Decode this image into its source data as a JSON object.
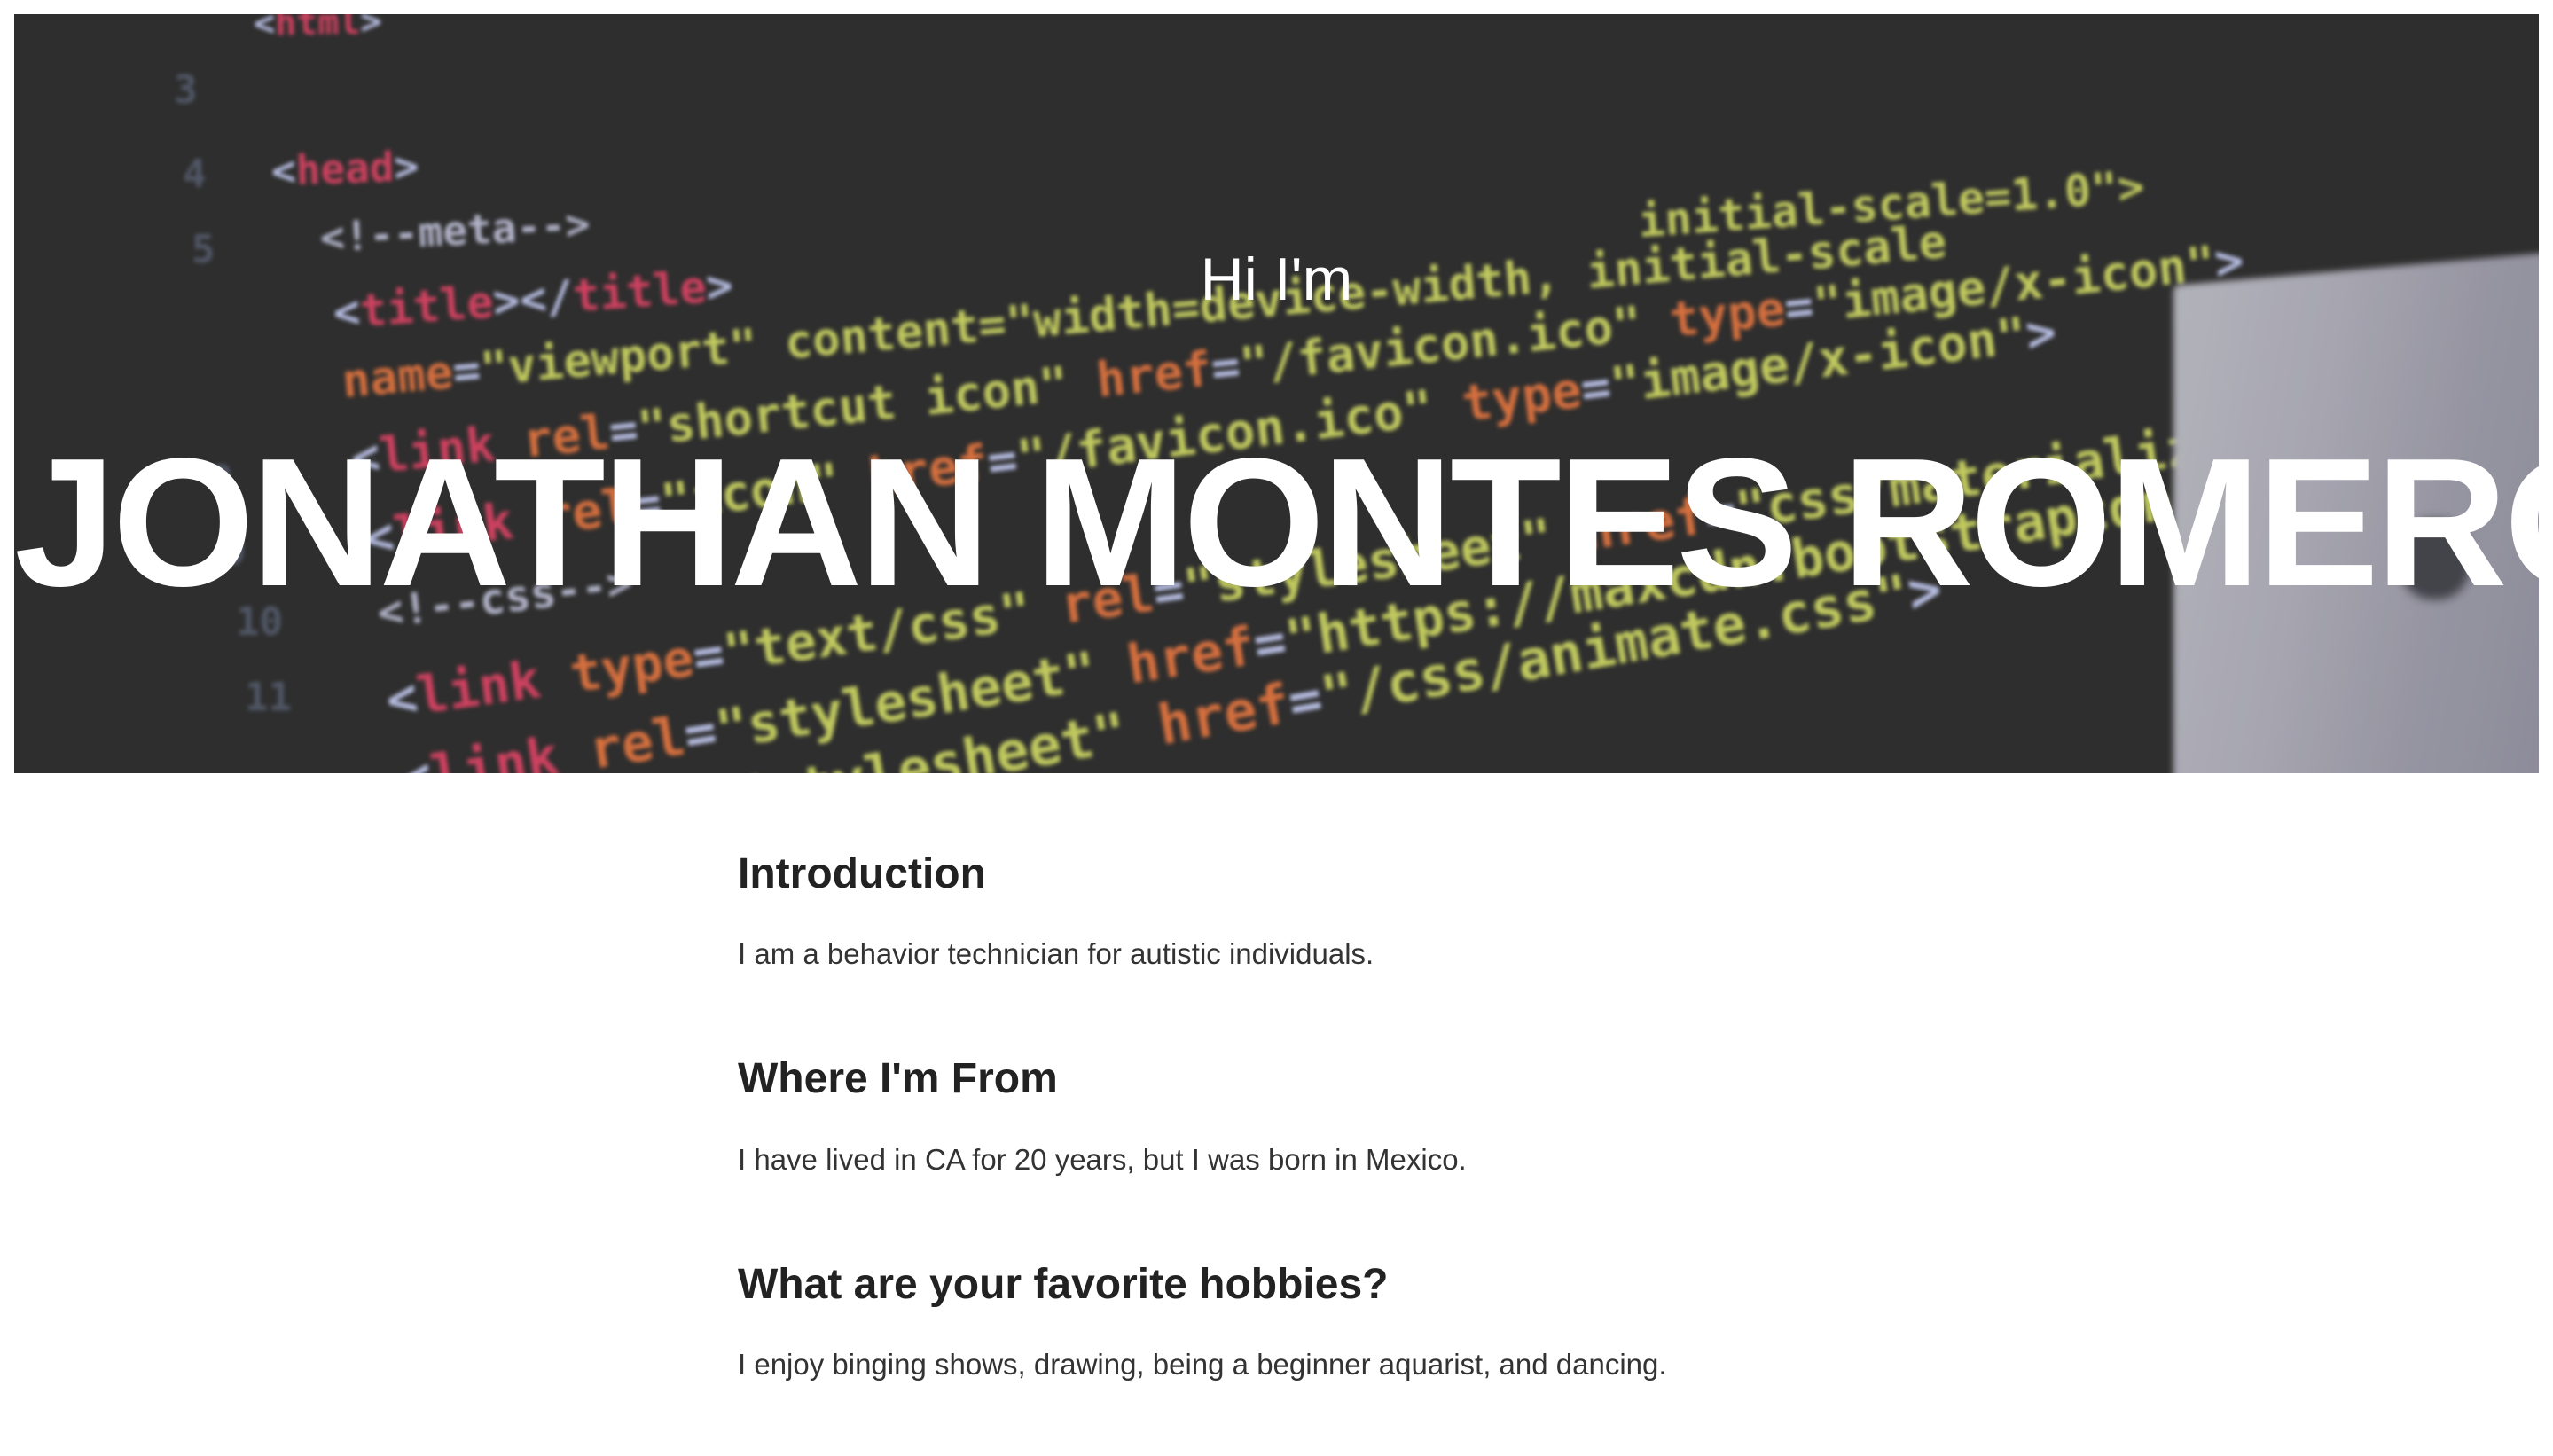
{
  "hero": {
    "greeting": "Hi I'm",
    "name": "JONATHAN MONTES ROMERO"
  },
  "sections": [
    {
      "heading": "Introduction",
      "text": "I am a behavior technician for autistic individuals."
    },
    {
      "heading": "Where I'm From",
      "text": "I have lived in CA for 20 years, but I was born in Mexico."
    },
    {
      "heading": "What are your favorite hobbies?",
      "text": "I enjoy binging shows, drawing, being a beginner aquarist, and dancing."
    }
  ],
  "colors": {
    "hero_background": "#333333",
    "heading": "#222222",
    "body_text": "#333333",
    "hero_text": "#ffffff"
  }
}
